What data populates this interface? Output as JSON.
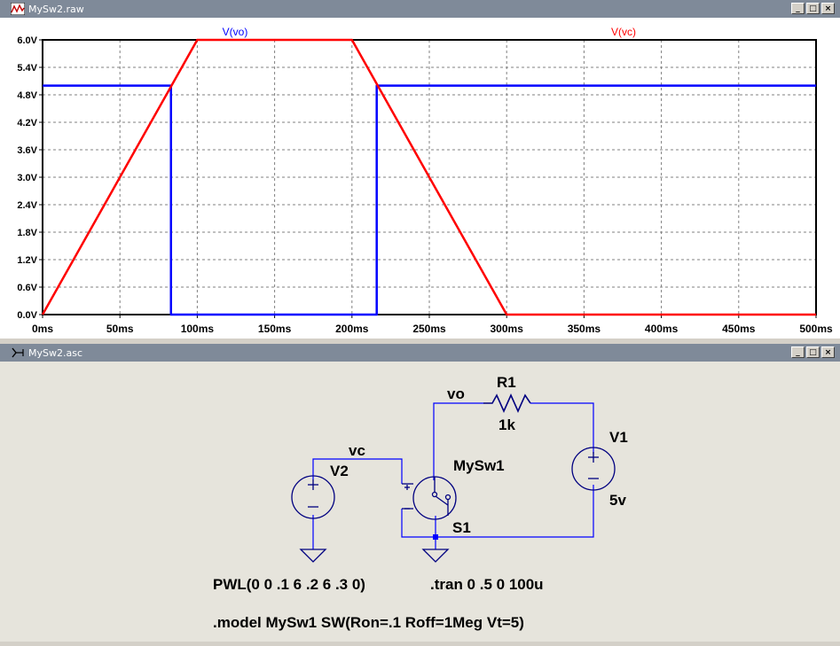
{
  "waveform_window": {
    "title": "MySw2.raw",
    "buttons": {
      "minimize": "_",
      "maximize": "□",
      "close": "×"
    }
  },
  "schematic_window": {
    "title": "MySw2.asc",
    "buttons": {
      "minimize": "_",
      "maximize": "□",
      "close": "×"
    }
  },
  "chart_data": {
    "type": "line",
    "xlabel": "",
    "ylabel": "",
    "x_ticks": [
      "0ms",
      "50ms",
      "100ms",
      "150ms",
      "200ms",
      "250ms",
      "300ms",
      "350ms",
      "400ms",
      "450ms",
      "500ms"
    ],
    "y_ticks": [
      "0.0V",
      "0.6V",
      "1.2V",
      "1.8V",
      "2.4V",
      "3.0V",
      "3.6V",
      "4.2V",
      "4.8V",
      "5.4V",
      "6.0V"
    ],
    "xlim": [
      0,
      500
    ],
    "ylim": [
      0,
      6
    ],
    "grid": true,
    "series": [
      {
        "name": "V(vo)",
        "color": "#0000ff",
        "x": [
          0,
          83,
          83,
          216,
          216,
          500
        ],
        "y": [
          5,
          5,
          0,
          0,
          5,
          5
        ]
      },
      {
        "name": "V(vc)",
        "color": "#ff0000",
        "x": [
          0,
          100,
          200,
          300,
          500
        ],
        "y": [
          0,
          6,
          6,
          0,
          0
        ]
      }
    ]
  },
  "schematic": {
    "nets": {
      "vo": "vo",
      "vc": "vc"
    },
    "r1": {
      "name": "R1",
      "value": "1k"
    },
    "v1": {
      "name": "V1",
      "value": "5v"
    },
    "v2": {
      "name": "V2"
    },
    "switch": {
      "model_label": "MySw1",
      "name": "S1"
    },
    "pwl": "PWL(0 0 .1 6 .2 6 .3 0)",
    "tran": ".tran 0 .5 0 100u",
    "model": ".model MySw1  SW(Ron=.1 Roff=1Meg Vt=5)",
    "colors": {
      "wire": "#0000ff",
      "component": "#000080"
    }
  }
}
